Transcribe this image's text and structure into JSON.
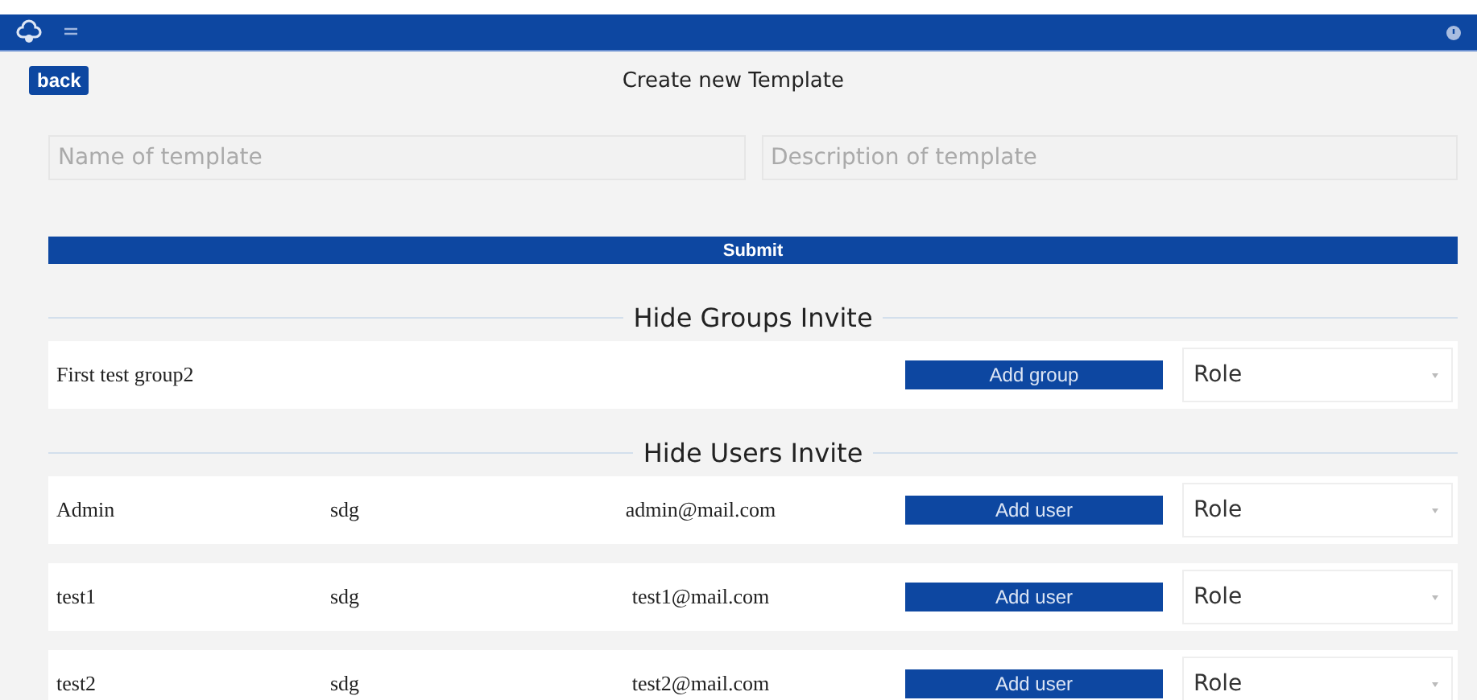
{
  "back_button": "back",
  "page_title": "Create new Template",
  "fields": [
    {
      "placeholder": "Name of template"
    },
    {
      "placeholder": "Description of template"
    }
  ],
  "submit_button": "Submit",
  "sections": [
    {
      "title": "Hide Groups Invite",
      "rows": [
        {
          "kind": "group",
          "name": "First test group2",
          "action": "Add group",
          "role": "Role"
        }
      ]
    },
    {
      "title": "Hide Users Invite",
      "rows": [
        {
          "kind": "user",
          "name": "Admin",
          "column_2": "sdg",
          "email": "admin@mail.com",
          "action": "Add user",
          "role": "Role"
        },
        {
          "kind": "user",
          "name": "test1",
          "column_2": "sdg",
          "email": "test1@mail.com",
          "action": "Add user",
          "role": "Role"
        },
        {
          "kind": "user",
          "name": "test2",
          "column_2": "sdg",
          "email": "test2@mail.com",
          "action": "Add user",
          "role": "Role"
        }
      ]
    }
  ]
}
